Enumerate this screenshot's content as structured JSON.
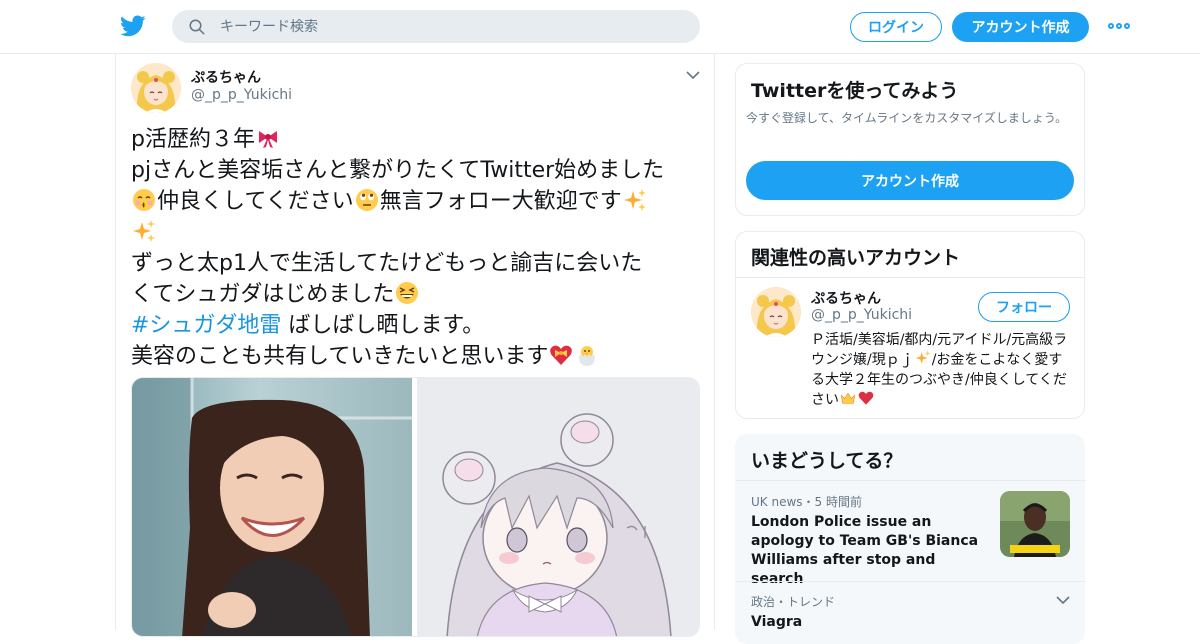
{
  "header": {
    "logo_icon": "twitter-bird-icon",
    "search_placeholder": "キーワード検索",
    "login_label": "ログイン",
    "signup_label": "アカウント作成",
    "more_icon": "more-dots-icon"
  },
  "colors": {
    "accent": "#1da1f2",
    "hashtag": "#1b95e0",
    "text_primary": "#14171a",
    "text_secondary": "#657786",
    "border": "#e6ecf0",
    "panel_bg": "#f5f8fa"
  },
  "tweet": {
    "display_name": "ぷるちゃん",
    "handle": "@_p_p_Yukichi",
    "lines": {
      "l1": "p活歴約３年",
      "l2": "pjさんと美容垢さんと繋がりたくてTwitter始めました",
      "l3a": "仲良くしてください",
      "l3b": "無言フォロー大歓迎です",
      "l5": "ずっと太p1人で生活してたけどもっと諭吉に会いた",
      "l6": "くてシュガダはじめました",
      "hashtag": "#シュガダ地雷",
      "l7": " ばしばし晒します。",
      "l8": "美容のことも共有していきたいと思います"
    },
    "emojis": [
      "ribbon-emoji",
      "kissing-face-emoji",
      "face-with-rolling-eyes-emoji",
      "sparkles-emoji",
      "sparkles-emoji",
      "grinning-squinting-face-emoji",
      "heart-with-ribbon-emoji",
      "hatching-chick-emoji"
    ],
    "media": [
      "photo-smiling-woman",
      "illustration-anime-girl"
    ]
  },
  "sidebar": {
    "signup_card": {
      "title": "Twitterを使ってみよう",
      "description": "今すぐ登録して、タイムラインをカスタマイズしましょう。",
      "button_label": "アカウント作成"
    },
    "related_card": {
      "title": "関連性の高いアカウント",
      "name": "ぷるちゃん",
      "handle": "@_p_p_Yukichi",
      "follow_label": "フォロー",
      "bio_a": "Ｐ活垢/美容垢/都内/元アイドル/元高級ラウンジ嬢/現ｐｊ",
      "bio_b": "/お金をこよなく愛する大学２年生のつぶやき/仲良くしてください"
    },
    "trends_card": {
      "title": "いまどうしてる？",
      "trend1_meta": "UK news・5 時間前",
      "trend1_title": "London Police issue an apology to Team GB's Bianca Williams after stop and search",
      "trend2_meta": "政治・トレンド",
      "trend2_title": "Viagra"
    }
  }
}
